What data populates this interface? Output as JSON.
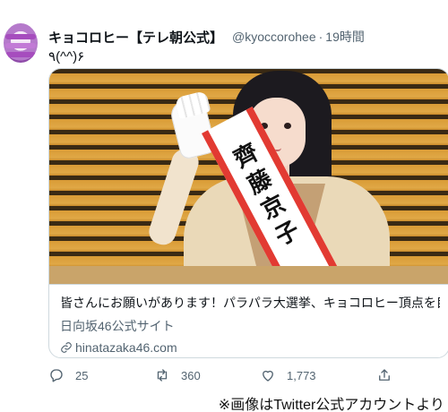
{
  "tweet": {
    "display_name": "キョコロヒー【テレ朝公式】",
    "handle": "@kyoccorohee",
    "separator": "·",
    "time": "19時間",
    "text": "٩(^^)۶"
  },
  "image": {
    "sash_chars": [
      "齊",
      "藤",
      "京",
      "子"
    ]
  },
  "card": {
    "title": "皆さんにお願いがあります！パラパラ大選挙、キョコロヒー頂点を目...",
    "site": "日向坂46公式サイト",
    "link": "hinatazaka46.com"
  },
  "actions": {
    "reply_count": "25",
    "retweet_count": "360",
    "like_count": "1,773",
    "icons": [
      "reply-icon",
      "retweet-icon",
      "like-icon",
      "share-icon"
    ]
  },
  "caption": "※画像はTwitter公式アカウントより",
  "colors": {
    "muted": "#536471",
    "border": "#cfd9de",
    "sash_red": "#e23a32"
  }
}
